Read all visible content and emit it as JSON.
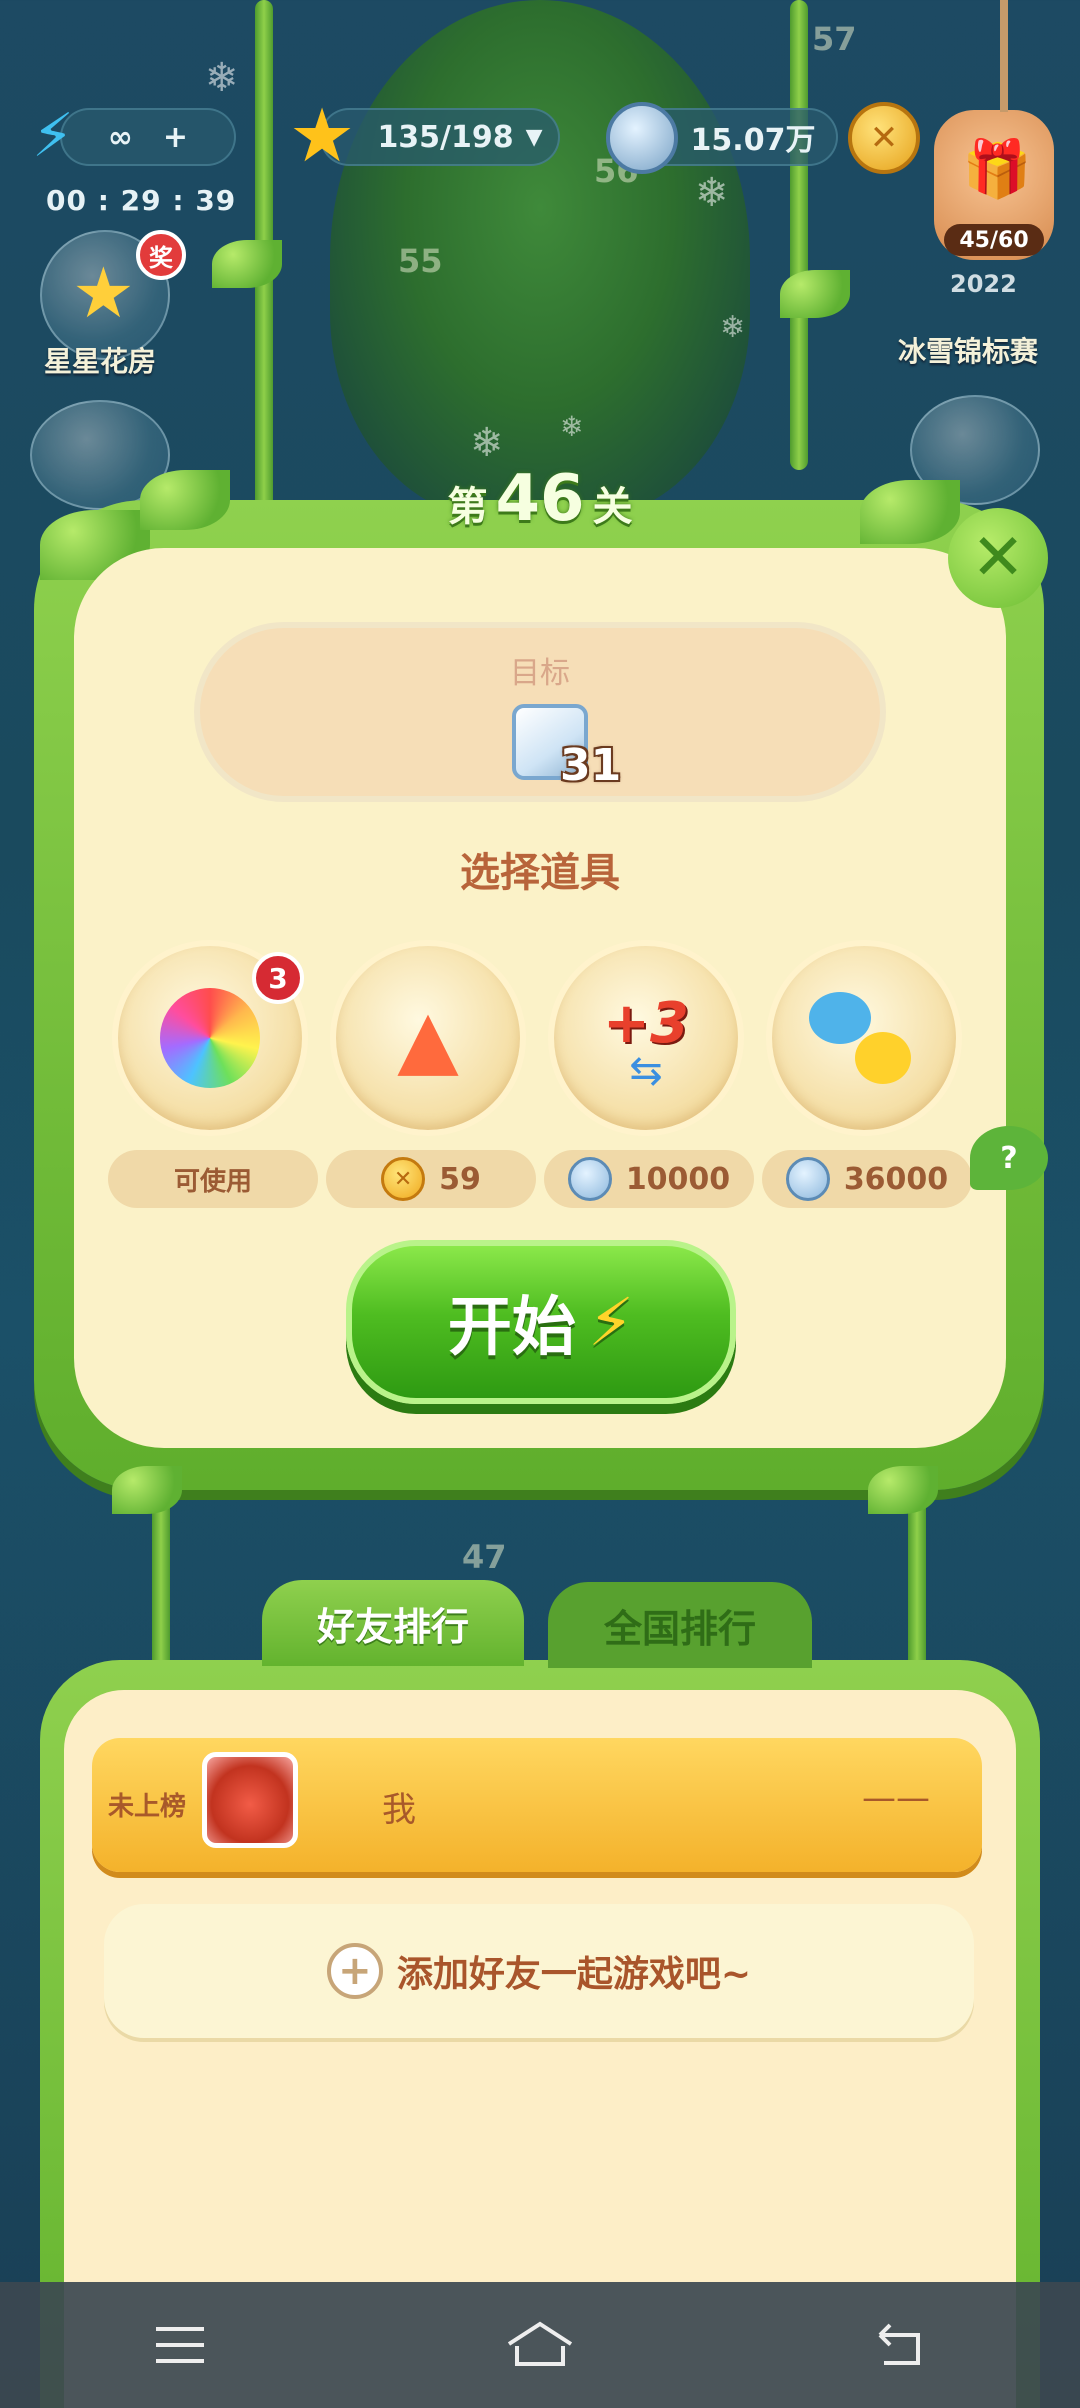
{
  "hud": {
    "lives": "∞",
    "lives_plus": "+",
    "timer": "00 : 29 : 39",
    "stars": "135/198",
    "silver_coins": "15.07万",
    "bg_level_top": "57",
    "bg_level_a": "56",
    "bg_level_b": "55",
    "bg_level_below": "47"
  },
  "side": {
    "star_garden_label": "星星花房",
    "star_garden_badge": "奖",
    "snow_event_label": "冰雪锦标赛",
    "snow_event_year": "2022",
    "gift_progress": "45/60"
  },
  "level_modal": {
    "title_prefix": "第",
    "level_number": "46",
    "title_suffix": "关",
    "close": "✕",
    "goal_label": "目标",
    "goal_count": "31",
    "select_items_title": "选择道具",
    "help": "?",
    "items": [
      {
        "name": "rainbow-bird",
        "badge": "3",
        "price": "可使用",
        "currency": ""
      },
      {
        "name": "firework-rockets",
        "badge": "",
        "price": "59",
        "currency": "gold"
      },
      {
        "name": "plus-three-moves",
        "badge": "",
        "price": "10000",
        "currency": "silver"
      },
      {
        "name": "animal-swap",
        "badge": "",
        "price": "36000",
        "currency": "silver"
      }
    ],
    "plus3_text": "+3",
    "start_label": "开始"
  },
  "ranking": {
    "tab_friends": "好友排行",
    "tab_national": "全国排行",
    "my_rank_status": "未上榜",
    "my_name": "我",
    "my_score": "——",
    "add_friend_text": "添加好友一起游戏吧~"
  },
  "nav": {
    "menu_icon": "☰",
    "home_icon": "⌂",
    "back_icon": "↩"
  },
  "colors": {
    "frame_green": "#63b32e",
    "panel_cream": "#fbf2c8",
    "accent_brown": "#b8643a",
    "badge_red": "#d62a33"
  }
}
